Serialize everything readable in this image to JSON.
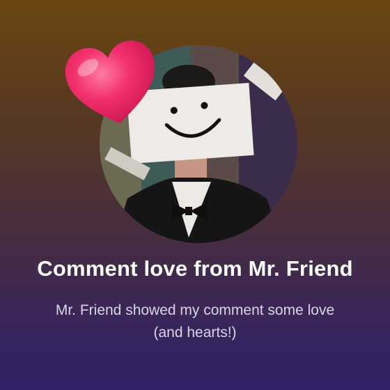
{
  "notification": {
    "title": "Comment love from Mr. Friend",
    "message": "Mr. Friend showed my comment some love (and hearts!)"
  },
  "colors": {
    "background_top": "#6b4611",
    "background_bottom": "#321f66",
    "heart": "#f0306a",
    "title_text": "#ffffff",
    "message_text": "#d8d6e2"
  },
  "icons": {
    "heart": "heart-icon",
    "avatar": "creator-avatar"
  }
}
